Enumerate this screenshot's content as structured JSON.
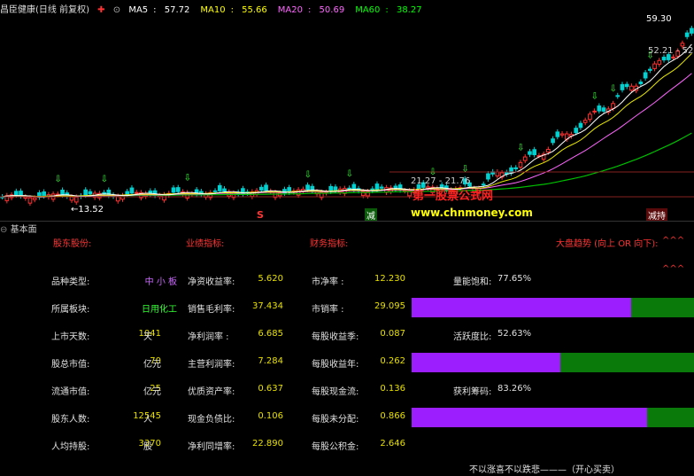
{
  "header": {
    "stock_label": "昌臣健康(日线 前复权)",
    "ma": [
      {
        "name": "MA5",
        "value": "57.72",
        "color": "#ffffff"
      },
      {
        "name": "MA10",
        "value": "55.66",
        "color": "#ffff00"
      },
      {
        "name": "MA20",
        "value": "50.69",
        "color": "#ff66ff"
      },
      {
        "name": "MA60",
        "value": "38.27",
        "color": "#00ff00"
      }
    ]
  },
  "chart_annotations": {
    "low_label": "←13.52",
    "mid_label": "21.27 - 21.76",
    "high_label": "59.30",
    "high_label2": "52.21 - 52",
    "marker_s": "S",
    "marker_jian": "减",
    "marker_jiancang": "减持",
    "watermark_title": "第一股票公式网",
    "watermark_url": "www.chnmoney.com"
  },
  "panel": {
    "title": "基本面"
  },
  "sections": {
    "shareholder": "股东股份:",
    "performance": "业绩指标:",
    "finance": "财务指标:",
    "trend": "大盘趋势 (向上 OR 向下):",
    "trend_arrows1": "^^^",
    "trend_arrows2": "^^^"
  },
  "col1": [
    {
      "label": "品种类型:",
      "value": "中 小 板",
      "unit": ""
    },
    {
      "label": "所属板块:",
      "value": "日用化工",
      "unit": ""
    },
    {
      "label": "上市天数:",
      "value": "1041",
      "unit": "天"
    },
    {
      "label": "股总市值:",
      "value": "70",
      "unit": "亿元"
    },
    {
      "label": "流通市值:",
      "value": "25",
      "unit": "亿元"
    },
    {
      "label": "股东人数:",
      "value": "12545",
      "unit": "人"
    },
    {
      "label": "人均持股:",
      "value": "3370",
      "unit": "股"
    }
  ],
  "col2": [
    {
      "label": "净资收益率:",
      "value": "5.620"
    },
    {
      "label": "销售毛利率:",
      "value": "37.434"
    },
    {
      "label": "净利润率 :",
      "value": "6.685"
    },
    {
      "label": "主营利润率:",
      "value": "7.284"
    },
    {
      "label": "优质资产率:",
      "value": "0.637"
    },
    {
      "label": "现金负债比:",
      "value": "0.106"
    },
    {
      "label": "净利同增率:",
      "value": "22.890"
    }
  ],
  "col3": [
    {
      "label": "市净率 :",
      "value": "12.230"
    },
    {
      "label": "市销率 :",
      "value": "29.095"
    },
    {
      "label": "每股收益季:",
      "value": "0.087"
    },
    {
      "label": "每股收益年:",
      "value": "0.262"
    },
    {
      "label": "每股现金流:",
      "value": "0.136"
    },
    {
      "label": "每股未分配:",
      "value": "0.866"
    },
    {
      "label": "每股公积金:",
      "value": "2.646"
    }
  ],
  "gauges": [
    {
      "label": "量能饱和:",
      "value": "77.65%",
      "fraction": 0.7765
    },
    {
      "label": "活跃度比:",
      "value": "52.63%",
      "fraction": 0.5263
    },
    {
      "label": "获利筹码:",
      "value": "83.26%",
      "fraction": 0.8326
    }
  ],
  "footer": {
    "text": "不以涨喜不以跌悲———（开心买卖）"
  }
}
